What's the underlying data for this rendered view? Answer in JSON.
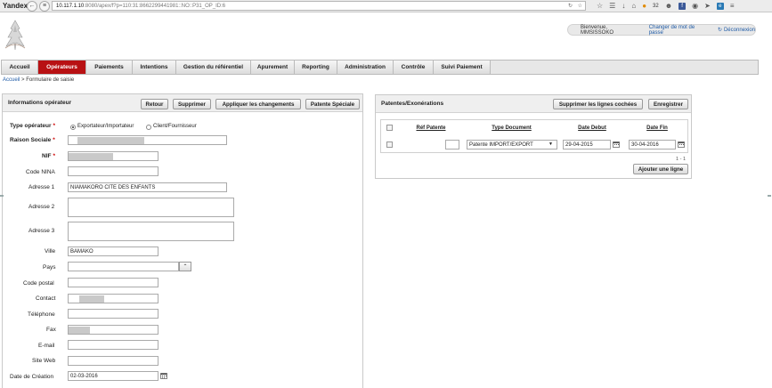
{
  "browser": {
    "brand": "Yandex",
    "url_host": "10.117.1.10",
    "url_path": ":8080/apex/f?p=110:31:8662299441981::NO::P31_OP_ID:6",
    "badge_count": "32"
  },
  "user": {
    "welcome": "Bienvenue, MMSISSOKO",
    "change_password": "Changer de mot de passe",
    "logout": "Déconnexion"
  },
  "menu": [
    {
      "label": "Accueil"
    },
    {
      "label": "Opérateurs"
    },
    {
      "label": "Paiements"
    },
    {
      "label": "Intentions"
    },
    {
      "label": "Gestion du référentiel"
    },
    {
      "label": "Apurement"
    },
    {
      "label": "Reporting"
    },
    {
      "label": "Administration"
    },
    {
      "label": "Contrôle"
    },
    {
      "label": "Suivi Paiement"
    }
  ],
  "breadcrumb": {
    "home": "Accueil",
    "sep": ">",
    "current": "Formulaire de saisie"
  },
  "operator": {
    "title": "Informations opérateur",
    "buttons": {
      "back": "Retour",
      "delete": "Supprimer",
      "apply": "Appliquer les changements",
      "special": "Patente Spéciale"
    },
    "type_label": "Type opérateur",
    "type_opt1": "Exportateur/Importateur",
    "type_opt2": "Client/Fournisseur",
    "raison_label": "Raison Sociale",
    "nif_label": "NIF",
    "nina_label": "Code NINA",
    "adresse1_label": "Adresse 1",
    "adresse1_value": "NIAMAKORO CITE DES ENFANTS",
    "adresse2_label": "Adresse 2",
    "adresse3_label": "Adresse 3",
    "ville_label": "Ville",
    "ville_value": "BAMAKO",
    "pays_label": "Pays",
    "postal_label": "Code postal",
    "contact_label": "Contact",
    "tel_label": "Téléphone",
    "fax_label": "Fax",
    "email_label": "E-mail",
    "web_label": "Site Web",
    "date_label": "Date de Création",
    "date_value": "02-03-2016",
    "required_mark": "*"
  },
  "patentes": {
    "title": "Patentes/Exonérations",
    "delete_button": "Supprimer les lignes cochées",
    "save_button": "Enregistrer",
    "columns": {
      "ref": "Réf Patente",
      "type": "Type Document",
      "debut": "Date Debut",
      "fin": "Date Fin"
    },
    "rows": [
      {
        "ref": "",
        "type": "Patente IMPORT/EXPORT",
        "debut": "29-04-2015",
        "fin": "30-04-2016"
      }
    ],
    "pagination": "1 - 1",
    "add_button": "Ajouter une ligne"
  }
}
